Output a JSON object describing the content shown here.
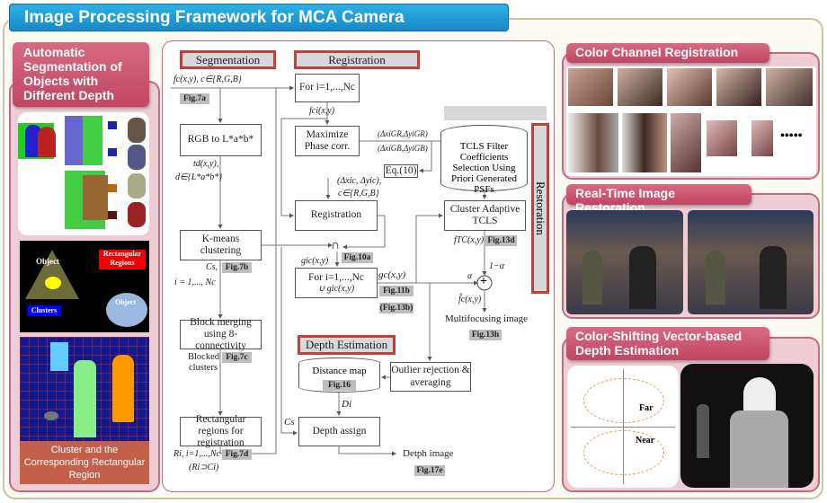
{
  "title": "Image Processing Framework for MCA Camera",
  "left_panel": {
    "header": "Automatic Segmentation of Objects with Different Depth",
    "diagram_object_1": "Object",
    "diagram_object_2": "Object",
    "diagram_rect_regions": "Rectangular Regions",
    "diagram_clusters": "Clusters",
    "caption": "Cluster and the Corresponding Rectangular Region"
  },
  "flow": {
    "segmentation_label": "Segmentation",
    "registration_label": "Registration",
    "restoration_label": "Restoration",
    "depth_label": "Depth Estimation",
    "input": "fc(x,y), c∈{R,G,B}",
    "fig7a": "Fig.7a",
    "rgb_box": "RGB to L*a*b*",
    "td": "td(x,y),",
    "d_set": "d∈{L*a*b*}",
    "kmeans_box": "K-means clustering",
    "cs": "Cs,",
    "fig7b": "Fig.7b",
    "i_range": "i = 1,..., Nc",
    "block_box": "Block merging using 8-connectivity",
    "blocked": "Blocked clusters",
    "fig7c": "Fig.7c",
    "rect_box": "Rectangular regions for registration",
    "ri": "Ri, i=1,...,Nc",
    "ri_sup": "(Ri⊃Ci)",
    "fig7d": "Fig.7d",
    "for_box": "For i=1,...,Nc",
    "fci": "fci(x,y)",
    "phase_box": "Maximize Phase corr.",
    "dgr": "(ΔxiGR,ΔyiGR)",
    "dgb": "(ΔxiGB,ΔyiGB)",
    "eq10": "Eq.(10)",
    "dxc": "(Δxic, Δyic),",
    "c_set": "c∈{R,G,B}",
    "reg_box": "Registration",
    "gci": "gic(x,y)",
    "fig10a": "Fig.10a",
    "intersect": "∩",
    "for_union_box_1": "For i=1,...,Nc",
    "for_union_box_2": "∪ gic(x,y)",
    "gc": "gc(x,y)",
    "fig11b": "Fig.11b",
    "fig13b": "(Fig.13b)",
    "tcls_db": "TCLS Filter Coefficients Selection Using Priori Generated PSFs",
    "cluster_tcls": "Cluster Adaptive TCLS",
    "fct": "fTC(x,y)",
    "fig13d": "Fig.13d",
    "alpha": "α",
    "one_minus_alpha": "1−α",
    "plus": "+",
    "fhat": "f̂c(x,y)",
    "multifocus": "Multifocusing image",
    "fig13h": "Fig.13h",
    "distance_map": "Distance map",
    "fig16": "Fig.16",
    "outlier_box": "Outlier rejection & averaging",
    "di": "Di",
    "cs2": "Cs",
    "depth_box": "Depth assign",
    "depth_image": "Detph image",
    "fig17e": "Fig.17e"
  },
  "right_panels": {
    "color_reg": "Color Channel Registration",
    "restoration": "Real-Time Image Restoration",
    "depth": "Color-Shifting Vector-based Depth Estimation",
    "far": "Far",
    "near": "Near"
  }
}
